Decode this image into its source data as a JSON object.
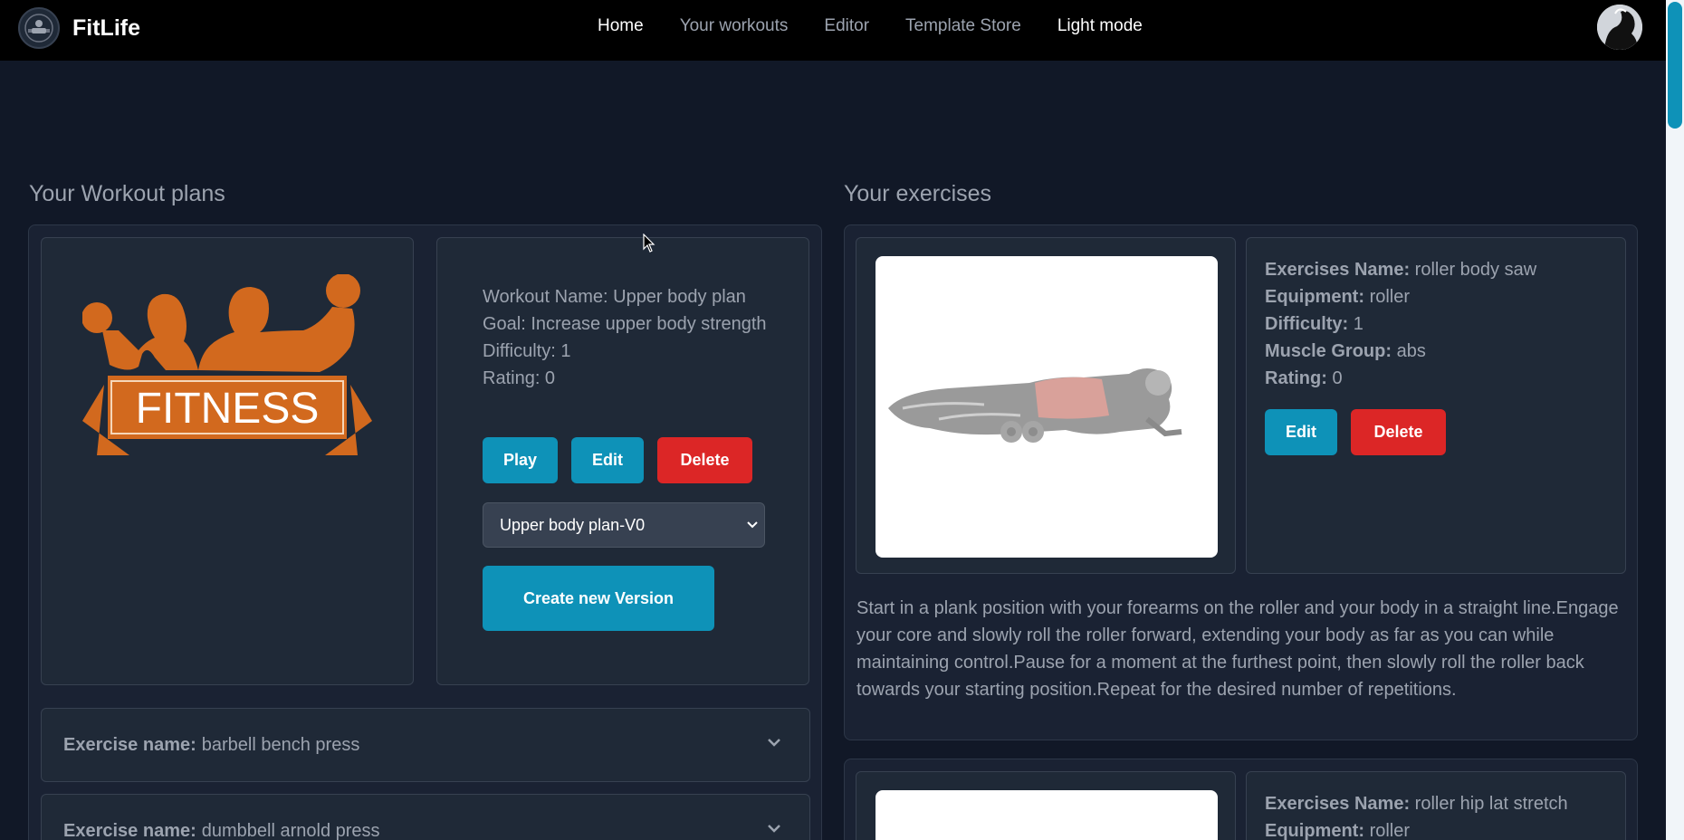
{
  "navbar": {
    "brand": "FitLife",
    "links": [
      {
        "label": "Home",
        "state": "active"
      },
      {
        "label": "Your workouts",
        "state": "normal"
      },
      {
        "label": "Editor",
        "state": "normal"
      },
      {
        "label": "Template Store",
        "state": "normal"
      },
      {
        "label": "Light mode",
        "state": "white"
      }
    ]
  },
  "workouts": {
    "section_title": "Your Workout plans",
    "logo_text": "FITNESS",
    "name_line": "Workout Name: Upper body plan",
    "goal_line": "Goal: Increase upper body strength",
    "difficulty_line": "Difficulty: 1",
    "rating_line": "Rating: 0",
    "play_label": "Play",
    "edit_label": "Edit",
    "delete_label": "Delete",
    "version_select": "Upper body plan-V0",
    "create_version_label": "Create new Version",
    "exercise_label": "Exercise name:",
    "exercises": [
      {
        "name": "barbell bench press"
      },
      {
        "name": "dumbbell arnold press"
      }
    ]
  },
  "exercises": {
    "section_title": "Your exercises",
    "labels": {
      "name": "Exercises Name:",
      "equipment": "Equipment:",
      "difficulty": "Difficulty:",
      "muscle": "Muscle Group:",
      "rating": "Rating:"
    },
    "edit_label": "Edit",
    "delete_label": "Delete",
    "items": [
      {
        "name": "roller body saw",
        "equipment": "roller",
        "difficulty": "1",
        "muscle": "abs",
        "rating": "0",
        "description": "Start in a plank position with your forearms on the roller and your body in a straight line.Engage your core and slowly roll the roller forward, extending your body as far as you can while maintaining control.Pause for a moment at the furthest point, then slowly roll the roller back towards your starting position.Repeat for the desired number of repetitions."
      },
      {
        "name": "roller hip lat stretch",
        "equipment": "roller"
      }
    ]
  },
  "colors": {
    "background": "#111827",
    "navbar": "#000000",
    "accent": "#0e92b8",
    "danger": "#dc2626",
    "logo_orange": "#d2691e"
  }
}
